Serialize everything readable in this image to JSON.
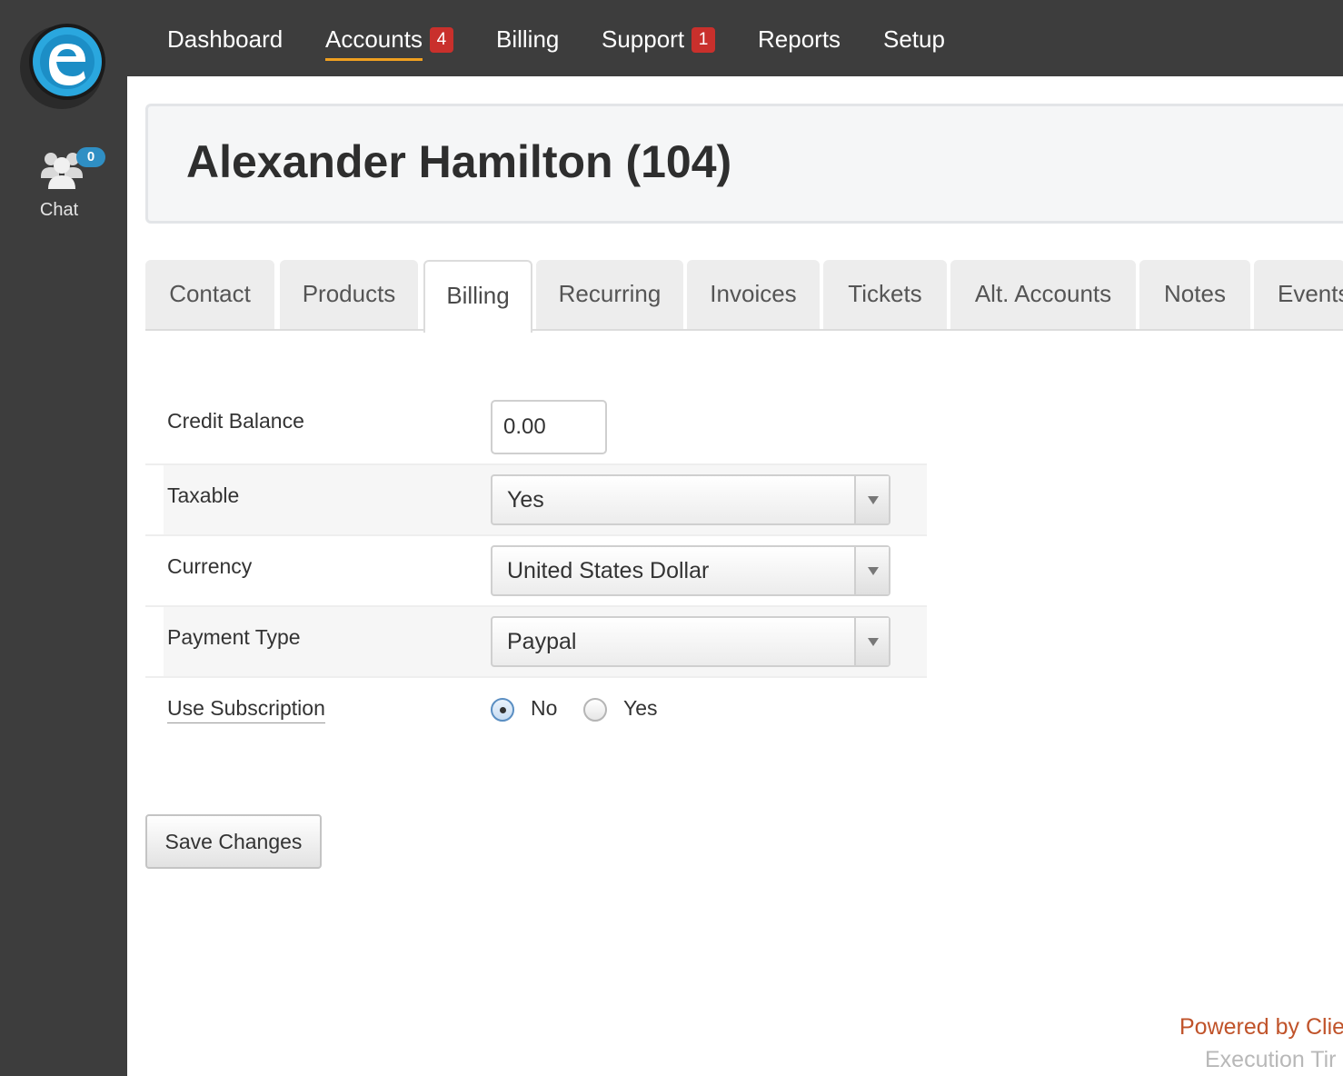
{
  "nav": {
    "items": [
      {
        "label": "Dashboard",
        "badge": ""
      },
      {
        "label": "Accounts",
        "badge": "4"
      },
      {
        "label": "Billing",
        "badge": ""
      },
      {
        "label": "Support",
        "badge": "1"
      },
      {
        "label": "Reports",
        "badge": ""
      },
      {
        "label": "Setup",
        "badge": ""
      }
    ],
    "active": "Accounts"
  },
  "sidebar": {
    "logo_icon": "e-logo-icon",
    "chat_label": "Chat",
    "chat_count": "0"
  },
  "page": {
    "title": "Alexander Hamilton (104)"
  },
  "tabs": [
    {
      "label": "Contact"
    },
    {
      "label": "Products"
    },
    {
      "label": "Billing"
    },
    {
      "label": "Recurring"
    },
    {
      "label": "Invoices"
    },
    {
      "label": "Tickets"
    },
    {
      "label": "Alt. Accounts"
    },
    {
      "label": "Notes"
    },
    {
      "label": "Events"
    }
  ],
  "active_tab": "Billing",
  "form": {
    "credit_balance": {
      "label": "Credit Balance",
      "value": "0.00"
    },
    "taxable": {
      "label": "Taxable",
      "value": "Yes"
    },
    "currency": {
      "label": "Currency",
      "value": "United States Dollar"
    },
    "payment_type": {
      "label": "Payment Type",
      "value": "Paypal"
    },
    "use_subscription": {
      "label": "Use Subscription",
      "options": [
        "No",
        "Yes"
      ],
      "selected": "No"
    }
  },
  "save_button_label": "Save Changes",
  "footer": {
    "powered_by": "Powered by Clie",
    "execution_time": "Execution Tir"
  },
  "colors": {
    "sidebar_bg": "#3d3d3d",
    "active_underline": "#f0a020",
    "badge_red": "#c9302c",
    "chat_badge_blue": "#2f8fc4",
    "powered_orange": "#c0532a"
  }
}
